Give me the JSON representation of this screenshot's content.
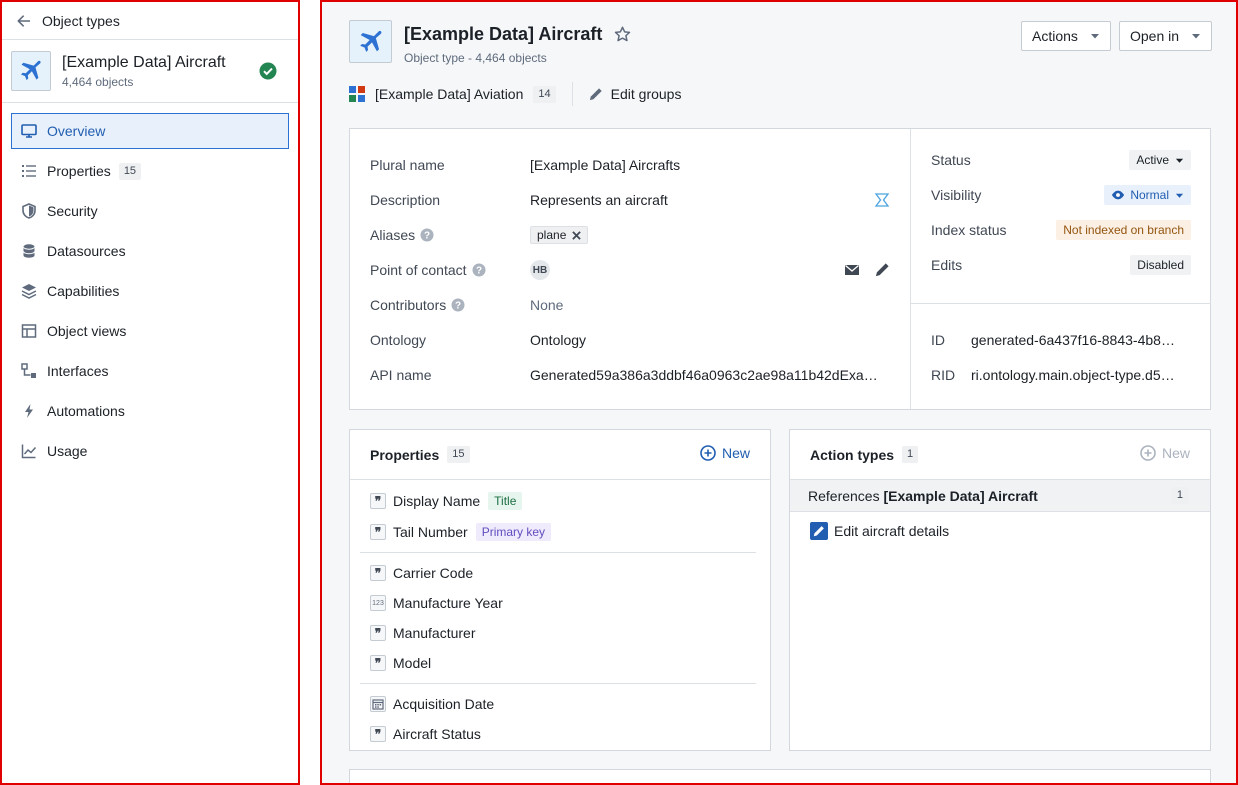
{
  "sidebar": {
    "back_label": "Object types",
    "object": {
      "name": "[Example Data] Aircraft",
      "count": "4,464 objects"
    },
    "items": [
      {
        "label": "Overview",
        "icon": "monitor-icon",
        "badge": ""
      },
      {
        "label": "Properties",
        "icon": "list-icon",
        "badge": "15"
      },
      {
        "label": "Security",
        "icon": "shield-icon",
        "badge": ""
      },
      {
        "label": "Datasources",
        "icon": "database-icon",
        "badge": ""
      },
      {
        "label": "Capabilities",
        "icon": "layers-icon",
        "badge": ""
      },
      {
        "label": "Object views",
        "icon": "layout-icon",
        "badge": ""
      },
      {
        "label": "Interfaces",
        "icon": "interface-icon",
        "badge": ""
      },
      {
        "label": "Automations",
        "icon": "lightning-icon",
        "badge": ""
      },
      {
        "label": "Usage",
        "icon": "chart-line-icon",
        "badge": ""
      }
    ]
  },
  "header": {
    "title": "[Example Data] Aircraft",
    "subtitle": "Object type - 4,464 objects",
    "actions_label": "Actions",
    "open_in_label": "Open in",
    "group_name": "[Example Data] Aviation",
    "group_count": "14",
    "edit_groups_label": "Edit groups"
  },
  "info": {
    "plural_name": {
      "label": "Plural name",
      "value": "[Example Data] Aircrafts"
    },
    "description": {
      "label": "Description",
      "value": "Represents an aircraft"
    },
    "aliases": {
      "label": "Aliases",
      "value": "plane"
    },
    "point_of_contact": {
      "label": "Point of contact",
      "value": "HB"
    },
    "contributors": {
      "label": "Contributors",
      "value": "None"
    },
    "ontology": {
      "label": "Ontology",
      "value": "Ontology"
    },
    "api_name": {
      "label": "API name",
      "value": "Generated59a386a3ddbf46a0963c2ae98a11b42dExample…"
    }
  },
  "status_panel": {
    "status": {
      "label": "Status",
      "value": "Active"
    },
    "visibility": {
      "label": "Visibility",
      "value": "Normal"
    },
    "index_status": {
      "label": "Index status",
      "value": "Not indexed on branch"
    },
    "edits": {
      "label": "Edits",
      "value": "Disabled"
    },
    "id": {
      "label": "ID",
      "value": "generated-6a437f16-8843-4b82-8…"
    },
    "rid": {
      "label": "RID",
      "value": "ri.ontology.main.object-type.d5d…"
    }
  },
  "properties_card": {
    "title": "Properties",
    "count": "15",
    "new_label": "New",
    "items": [
      {
        "name": "Display Name",
        "type": "string",
        "tag": "Title"
      },
      {
        "name": "Tail Number",
        "type": "string",
        "tag": "Primary key"
      },
      {
        "name": "Carrier Code",
        "type": "string",
        "tag": ""
      },
      {
        "name": "Manufacture Year",
        "type": "number",
        "tag": ""
      },
      {
        "name": "Manufacturer",
        "type": "string",
        "tag": ""
      },
      {
        "name": "Model",
        "type": "string",
        "tag": ""
      },
      {
        "name": "Acquisition Date",
        "type": "date",
        "tag": ""
      },
      {
        "name": "Aircraft Status",
        "type": "string",
        "tag": ""
      }
    ],
    "number_type_glyph": "123",
    "string_type_glyph": "❞"
  },
  "actions_card": {
    "title": "Action types",
    "count": "1",
    "new_label": "New",
    "reference_prefix": "References ",
    "reference_object": "[Example Data] Aircraft",
    "reference_count": "1",
    "items": [
      {
        "label": "Edit aircraft details"
      }
    ]
  },
  "colors": {
    "accent": "#2d72d2",
    "success": "#238551",
    "highlight_border": "#e00000"
  }
}
